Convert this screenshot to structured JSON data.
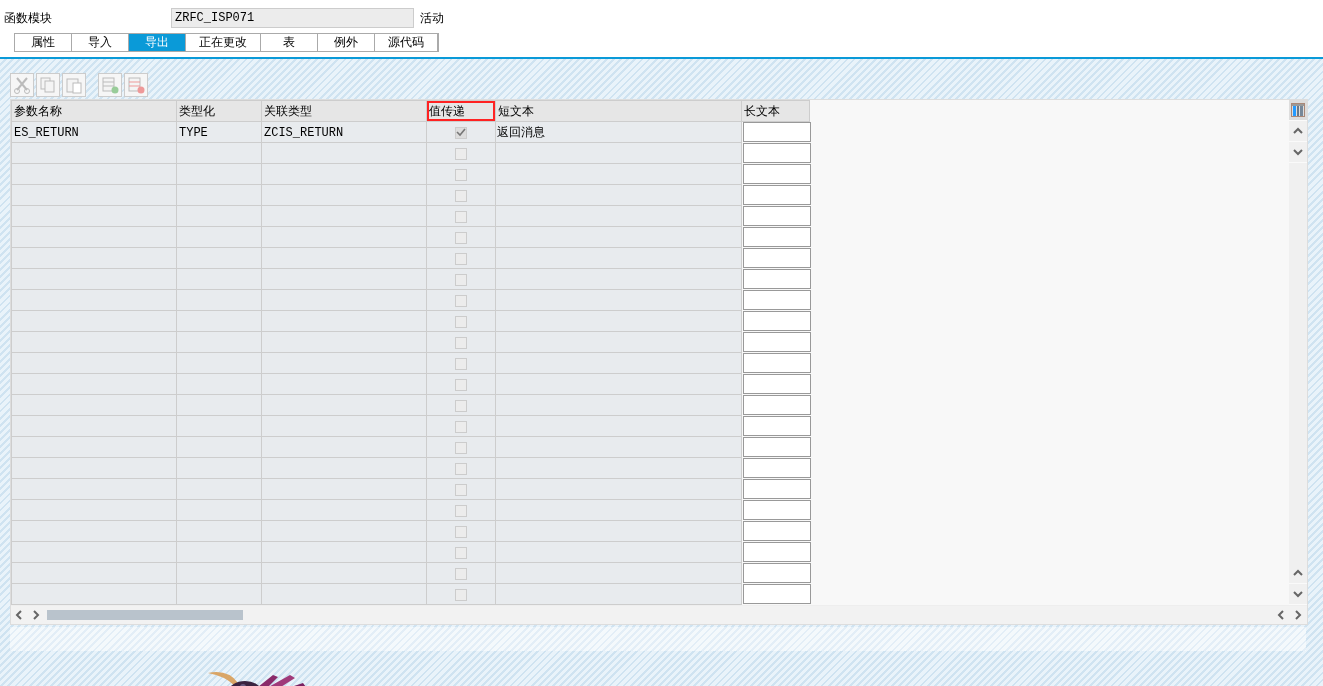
{
  "header": {
    "label": "函数模块",
    "value": "ZRFC_ISP071",
    "status": "活动"
  },
  "tabs": [
    {
      "label": "属性",
      "selected": false
    },
    {
      "label": "导入",
      "selected": false
    },
    {
      "label": "导出",
      "selected": true
    },
    {
      "label": "正在更改",
      "selected": false
    },
    {
      "label": "表",
      "selected": false
    },
    {
      "label": "例外",
      "selected": false
    },
    {
      "label": "源代码",
      "selected": false
    }
  ],
  "table": {
    "columns": [
      {
        "label": "参数名称",
        "highlighted": false
      },
      {
        "label": "类型化",
        "highlighted": false
      },
      {
        "label": "关联类型",
        "highlighted": false
      },
      {
        "label": "值传递",
        "highlighted": true
      },
      {
        "label": "短文本",
        "highlighted": false
      },
      {
        "label": "长文本",
        "highlighted": false
      }
    ],
    "rows": [
      {
        "name": "ES_RETURN",
        "typing": "TYPE",
        "ref_type": "ZCIS_RETURN",
        "pass_by_value": true,
        "short_text": "返回消息"
      },
      {
        "pass_by_value": false
      },
      {
        "pass_by_value": false
      },
      {
        "pass_by_value": false
      },
      {
        "pass_by_value": false
      },
      {
        "pass_by_value": false
      },
      {
        "pass_by_value": false
      },
      {
        "pass_by_value": false
      },
      {
        "pass_by_value": false
      },
      {
        "pass_by_value": false
      },
      {
        "pass_by_value": false
      },
      {
        "pass_by_value": false
      },
      {
        "pass_by_value": false
      },
      {
        "pass_by_value": false
      },
      {
        "pass_by_value": false
      },
      {
        "pass_by_value": false
      },
      {
        "pass_by_value": false
      },
      {
        "pass_by_value": false
      },
      {
        "pass_by_value": false
      },
      {
        "pass_by_value": false
      },
      {
        "pass_by_value": false
      },
      {
        "pass_by_value": false
      },
      {
        "pass_by_value": false
      }
    ]
  }
}
